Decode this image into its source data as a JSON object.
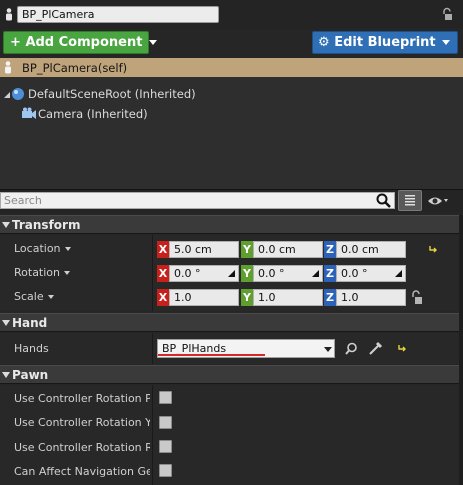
{
  "blueprint": {
    "name": "BP_PlCamera"
  },
  "toolbar": {
    "add_component_label": "Add Component",
    "edit_blueprint_label": "Edit Blueprint"
  },
  "components": {
    "self_label": "BP_PlCamera(self)",
    "root_label": "DefaultSceneRoot (Inherited)",
    "camera_label": "Camera (Inherited)"
  },
  "search": {
    "placeholder": "Search"
  },
  "transform": {
    "title": "Transform",
    "location": {
      "label": "Location",
      "x": "5.0 cm",
      "y": "0.0 cm",
      "z": "0.0 cm"
    },
    "rotation": {
      "label": "Rotation",
      "x": "0.0 °",
      "y": "0.0 °",
      "z": "0.0 °"
    },
    "scale": {
      "label": "Scale",
      "x": "1.0",
      "y": "1.0",
      "z": "1.0"
    },
    "axis_labels": {
      "x": "X",
      "y": "Y",
      "z": "Z"
    }
  },
  "hand": {
    "title": "Hand",
    "hands_label": "Hands",
    "hands_value": "BP_PlHands"
  },
  "pawn": {
    "title": "Pawn",
    "use_controller_rotation_pitch": "Use Controller Rotation Pitc",
    "use_controller_rotation_yaw": "Use Controller Rotation Yaw",
    "use_controller_rotation_roll": "Use Controller Rotation Roll",
    "can_affect_navigation": "Can Affect Navigation Gene"
  },
  "colors": {
    "add_button": "#49a53f",
    "edit_button": "#2f6fb5",
    "selected_row": "#bfa37a",
    "axis_x": "#c8201b",
    "axis_y": "#5e9f2e",
    "axis_z": "#2c63b8",
    "reset_arrow": "#e5d43a"
  },
  "icons": {
    "blueprint": "blueprint-actor-icon",
    "lock": "lock-icon",
    "scene_root": "scene-root-icon",
    "camera": "camera-icon",
    "search": "search-icon",
    "list_view": "list-view-icon",
    "eye": "eye-visibility-icon",
    "reset": "reset-to-default-icon",
    "find": "find-in-browser-icon",
    "picker": "eyedropper-icon"
  }
}
